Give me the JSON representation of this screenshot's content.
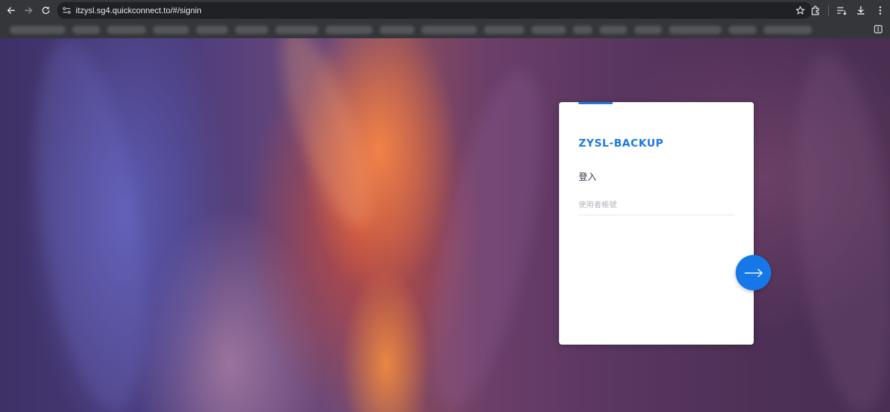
{
  "browser": {
    "url": "itzysl.sg4.quickconnect.to/#/signin",
    "nav_icons": [
      "back-arrow-icon",
      "forward-arrow-icon",
      "reload-icon"
    ],
    "toolbar_icons": [
      "extensions-icon",
      "reading-list-icon",
      "download-icon",
      "more-vert-icon"
    ]
  },
  "login": {
    "server_name": "ZYSL-BACKUP",
    "heading": "登入",
    "username_placeholder": "使用者帳號",
    "username_value": "",
    "submit_icon": "arrow-right-icon"
  },
  "colors": {
    "accent": "#1d7be0",
    "button": "#1677e8",
    "card": "#ffffff",
    "chrome": "#35363a"
  }
}
